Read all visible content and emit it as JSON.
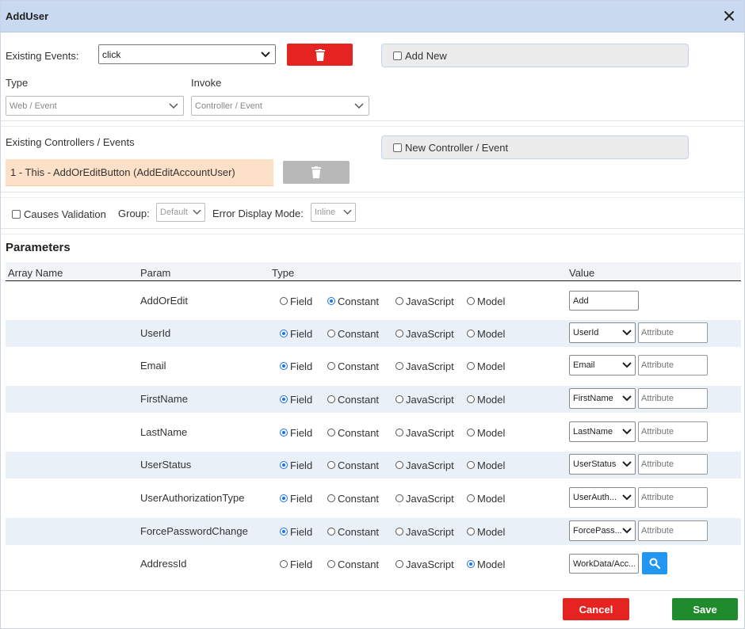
{
  "dialog": {
    "title": "AddUser"
  },
  "events": {
    "existing_label": "Existing Events:",
    "existing_value": "click",
    "add_new_label": "Add New",
    "type_label": "Type",
    "type_value": "Web / Event",
    "invoke_label": "Invoke",
    "invoke_value": "Controller / Event"
  },
  "controllers": {
    "label": "Existing Controllers / Events",
    "new_label": "New Controller / Event",
    "selected_item": "1 - This - AddOrEditButton (AddEditAccountUser)"
  },
  "validation": {
    "causes_validation_label": "Causes Validation",
    "group_label": "Group:",
    "group_value": "Default",
    "error_mode_label": "Error Display Mode:",
    "error_mode_value": "Inline"
  },
  "parameters": {
    "title": "Parameters",
    "columns": {
      "array_name": "Array Name",
      "param": "Param",
      "type": "Type",
      "value": "Value"
    },
    "type_options": {
      "field": "Field",
      "constant": "Constant",
      "javascript": "JavaScript",
      "model": "Model"
    },
    "attribute_placeholder": "Attribute",
    "rows": [
      {
        "param": "AddOrEdit",
        "type": "constant",
        "value": "Add"
      },
      {
        "param": "UserId",
        "type": "field",
        "value": "UserId"
      },
      {
        "param": "Email",
        "type": "field",
        "value": "Email"
      },
      {
        "param": "FirstName",
        "type": "field",
        "value": "FirstName"
      },
      {
        "param": "LastName",
        "type": "field",
        "value": "LastName"
      },
      {
        "param": "UserStatus",
        "type": "field",
        "value": "UserStatus"
      },
      {
        "param": "UserAuthorizationType",
        "type": "field",
        "value": "UserAuth..."
      },
      {
        "param": "ForcePasswordChange",
        "type": "field",
        "value": "ForcePass..."
      },
      {
        "param": "AddressId",
        "type": "model",
        "value": "WorkData/Acc..."
      }
    ]
  },
  "footer": {
    "cancel_label": "Cancel",
    "save_label": "Save"
  },
  "colors": {
    "danger": "#e52421",
    "success": "#1f8b2c",
    "primary": "#2196f3",
    "header": "#c9daf0",
    "row_stripe": "#eaf0f8"
  }
}
